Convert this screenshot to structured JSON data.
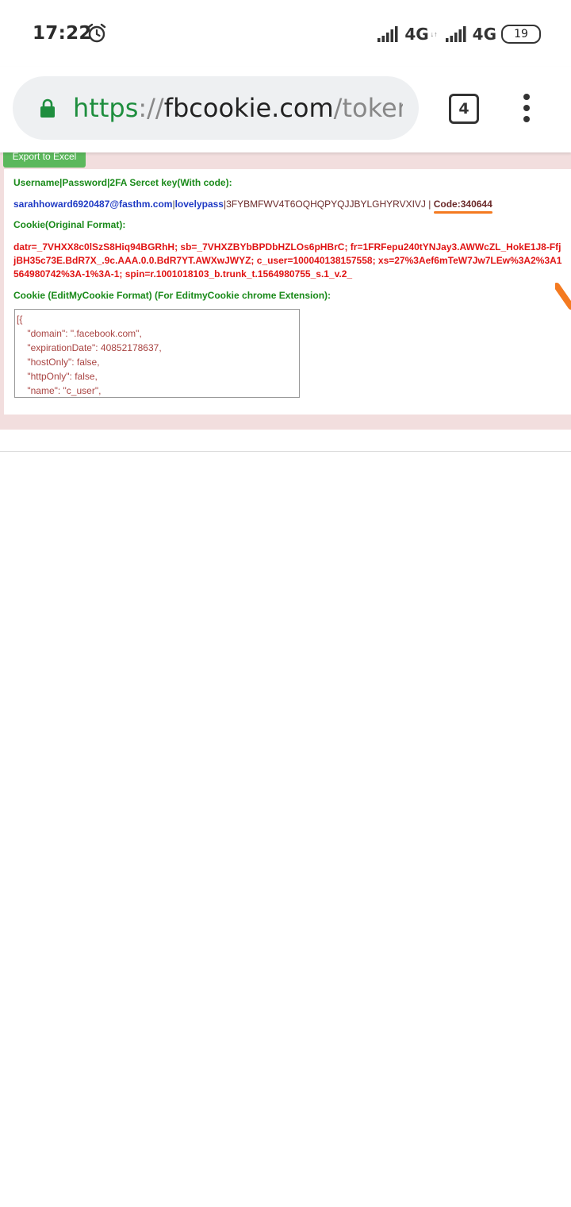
{
  "status_bar": {
    "time": "17:22",
    "icons": [
      "alarm-icon",
      "signal-icon",
      "signal-icon"
    ],
    "network1": "4G",
    "network2": "4G",
    "battery": "19"
  },
  "browser": {
    "url_scheme": "https",
    "url_sep": "://",
    "url_host": "fbcookie.com",
    "url_path": "/tokenlis",
    "tab_count": "4",
    "accent_color": "#1e8e3e"
  },
  "page": {
    "export_button": "Export to Excel",
    "label_credentials": "Username|Password|2FA Sercet key(With code):",
    "username": "sarahhoward6920487@fasthm.com",
    "pipe": "|",
    "password": "lovelypass",
    "secret_key": "|3FYBMFWV4T6OQHQPYQJJBYLGHYRVXIVJ | ",
    "code": "Code:340644",
    "label_cookie_original": "Cookie(Original Format):",
    "cookie_original": "datr=_7VHXX8c0lSzS8Hiq94BGRhH; sb=_7VHXZBYbBPDbHZLOs6pHBrC; fr=1FRFepu240tYNJay3.AWWcZL_HokE1J8-FfjjBH35c73E.BdR7X_.9c.AAA.0.0.BdR7YT.AWXwJWYZ; c_user=100040138157558; xs=27%3Aef6mTeW7Jw7LEw%3A2%3A1564980742%3A-1%3A-1; spin=r.1001018103_b.trunk_t.1564980755_s.1_v.2_",
    "label_cookie_edit": "Cookie (EditMyCookie Format) (For EditmyCookie chrome Extension):",
    "cookie_json": "[{\n    \"domain\": \".facebook.com\",\n    \"expirationDate\": 40852178637,\n    \"hostOnly\": false,\n    \"httpOnly\": false,\n    \"name\": \"c_user\","
  }
}
